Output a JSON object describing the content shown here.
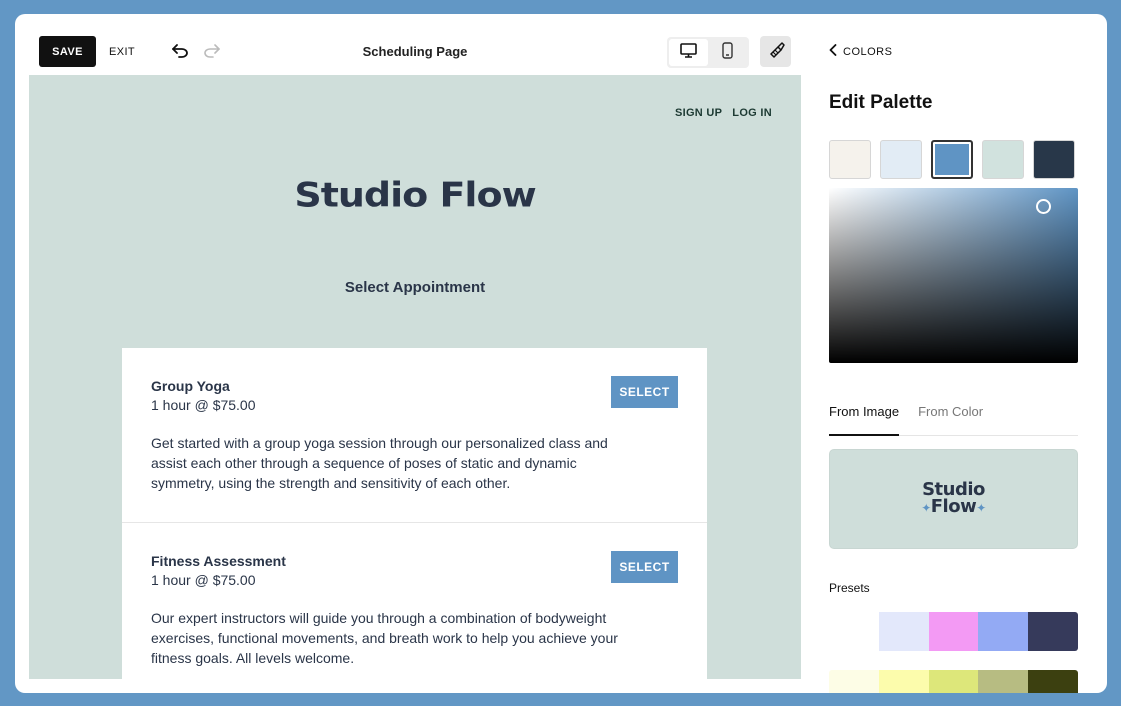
{
  "toolbar": {
    "save_label": "SAVE",
    "exit_label": "EXIT",
    "title": "Scheduling Page"
  },
  "site": {
    "nav": [
      "SIGN UP",
      "LOG IN"
    ],
    "logo": "Studio Flow",
    "heading": "Select Appointment",
    "appointments": [
      {
        "name": "Group Yoga",
        "price": "1 hour @ $75.00",
        "description": "Get started with a group yoga session through our personalized class and assist each other through a sequence of poses of static and dynamic symmetry, using the strength and sensitivity of each other.",
        "select_label": "SELECT"
      },
      {
        "name": "Fitness Assessment",
        "price": "1 hour @ $75.00",
        "description": "Our expert instructors will guide you through a combination of bodyweight exercises, functional movements, and breath work to help you achieve your fitness goals. All levels welcome.",
        "select_label": "SELECT"
      }
    ]
  },
  "panel": {
    "back_label": "COLORS",
    "title": "Edit Palette",
    "swatches": [
      "#f5f2ec",
      "#e2ecf5",
      "#5f94c4",
      "#d1e2de",
      "#283749"
    ],
    "selected_swatch": 2,
    "tabs": [
      "From Image",
      "From Color"
    ],
    "active_tab": 0,
    "image_logo_line1": "Studio",
    "image_logo_line2": "Flow",
    "presets_label": "Presets",
    "presets": [
      [
        "#ffffff",
        "#e3e8fb",
        "#f39af4",
        "#93aaf4",
        "#363a5b"
      ],
      [
        "#fdfde6",
        "#fcfcac",
        "#dde77a",
        "#b7bc82",
        "#3c4010"
      ]
    ]
  },
  "icons": {
    "undo": "undo-icon",
    "redo": "redo-icon",
    "desktop": "desktop-icon",
    "mobile": "mobile-icon",
    "brush": "paint-brush-icon",
    "back": "chevron-left-icon"
  }
}
